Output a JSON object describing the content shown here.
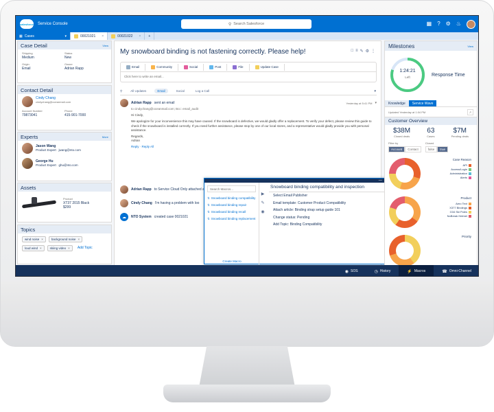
{
  "header": {
    "logo_text": "salesforce",
    "app_name": "Service Console",
    "search_placeholder": "Search Salesforce"
  },
  "tabs": {
    "nav_label": "Cases",
    "items": [
      {
        "label": "00021021"
      },
      {
        "label": "00021022"
      }
    ],
    "add": "+"
  },
  "case_detail": {
    "title": "Case Detail",
    "link": "View",
    "fields": [
      {
        "label": "Shipping",
        "value": "Medium"
      },
      {
        "label": "Status",
        "value": "New"
      },
      {
        "label": "Origin",
        "value": "Email"
      },
      {
        "label": "Owner",
        "value": "Adrian Rapp"
      }
    ]
  },
  "contact_detail": {
    "title": "Contact Detail",
    "name": "Cindy Chang",
    "email": "cindychang@oceanmail.com",
    "fields": [
      {
        "label": "Account Number",
        "value": "79873041"
      },
      {
        "label": "Phone",
        "value": "415-901-7000"
      }
    ]
  },
  "experts": {
    "title": "Experts",
    "link": "More",
    "items": [
      {
        "name": "Jason Wang",
        "role": "Product Expert",
        "email": "jwang@nto.com"
      },
      {
        "name": "George Hu",
        "role": "Product Expert",
        "email": "ghu@nto.com"
      }
    ]
  },
  "assets": {
    "title": "Assets",
    "product_label": "Product",
    "product_name": "XT37 2015 Black",
    "price": "$299"
  },
  "topics": {
    "title": "Topics",
    "pills": [
      "wind noise",
      "background noise",
      "loud wind",
      "skiing video"
    ],
    "add": "Add Topic"
  },
  "feed": {
    "title": "My snowboard binding is not fastening correctly. Please help!",
    "actions": [
      {
        "label": "Email",
        "color": "#95aec5"
      },
      {
        "label": "Community",
        "color": "#f9b44b"
      },
      {
        "label": "Social",
        "color": "#e35d9c"
      },
      {
        "label": "Post",
        "color": "#62b7ed"
      },
      {
        "label": "File",
        "color": "#8b6fd1"
      },
      {
        "label": "Update Case",
        "color": "#f2cf5b"
      }
    ],
    "placeholder": "Click here to write an email...",
    "filters": [
      "All Updates",
      "Email",
      "Social",
      "Log a Call"
    ],
    "email": {
      "author": "Adrian Rapp",
      "action": "sent an email",
      "time": "Yesterday at 5:41 PM",
      "to": "to cindychang@oceanmail.com; Bcc: email_audit",
      "greeting": "Hi Cindy,",
      "body": "We apologize for your inconvenience this may have caused. If the snowboard is defective, we would gladly offer a replacement. To verify your defect, please review this guide to check if the snowboard is installed correctly. If you need further assistance, please stop by one of our local stores, and a representative would gladly provide you with personal assistance.",
      "sign1": "Regards,",
      "sign2": "Adrian",
      "reply": "Reply",
      "reply_all": "Reply All"
    },
    "item2": {
      "author": "Adrian Rapp",
      "text": "to Service Cloud Only attached an article to the case",
      "time": "Yesterday at 5:41 PM"
    },
    "item3": {
      "author": "Cindy Chang",
      "text": "I'm having a problem with loo"
    },
    "item4": {
      "author": "NTO System",
      "text": "created case 0021021"
    }
  },
  "macros": {
    "search_placeholder": "Search Macros...",
    "items": [
      "Snowboard binding compatibility",
      "Snowboard binding repair",
      "Snowboard binding recall",
      "Snowboard binding replacement"
    ],
    "create": "Create Macro",
    "title": "Snowboard binding compatibility and inspection",
    "steps": [
      "Select Email Publisher",
      "Email template: Customer Product Compatibility",
      "Attach article: Binding strap setup guide 101",
      "Change status: Pending",
      "Add Topic: Binding Compatibility"
    ]
  },
  "milestones": {
    "title": "Milestones",
    "link": "View",
    "time": "1:24:21",
    "left": "Left",
    "label": "Response Time",
    "progress": 0.8
  },
  "right_tabs": {
    "knowledge": "Knowledge",
    "wave": "Service Wave"
  },
  "updated": "Updated Yesterday at 1:04 PM",
  "overview": {
    "title": "Customer Overview",
    "stats": [
      {
        "value": "$38M",
        "label": "Closed deals"
      },
      {
        "value": "63",
        "label": "Cases"
      },
      {
        "value": "$7M",
        "label": "Pending deals"
      }
    ],
    "filter_by": "Filter by",
    "toggle1": [
      "Account",
      "Contact"
    ],
    "closed": "Closed",
    "toggle2": [
      "false",
      "true"
    ],
    "case_reason": {
      "title": "Case Reason",
      "items": [
        {
          "label": "API",
          "color": "#e8612c"
        },
        {
          "label": "Access/Login",
          "color": "#7bc67b"
        },
        {
          "label": "Administration",
          "color": "#5bbcd6"
        },
        {
          "label": "Alerts",
          "color": "#e35d9c"
        }
      ]
    },
    "product": {
      "title": "Product",
      "items": [
        {
          "label": "Aero Text",
          "color": "#f7a44b"
        },
        {
          "label": "X377 Bindings",
          "color": "#e8612c"
        },
        {
          "label": "G34 Ski Poles",
          "color": "#f2cf5b"
        },
        {
          "label": "NoBreak Helmet",
          "color": "#e35d6d"
        }
      ]
    },
    "priority": {
      "title": "Priority"
    }
  },
  "utility": [
    "SOS",
    "History",
    "Macros",
    "Omni-Channel"
  ]
}
